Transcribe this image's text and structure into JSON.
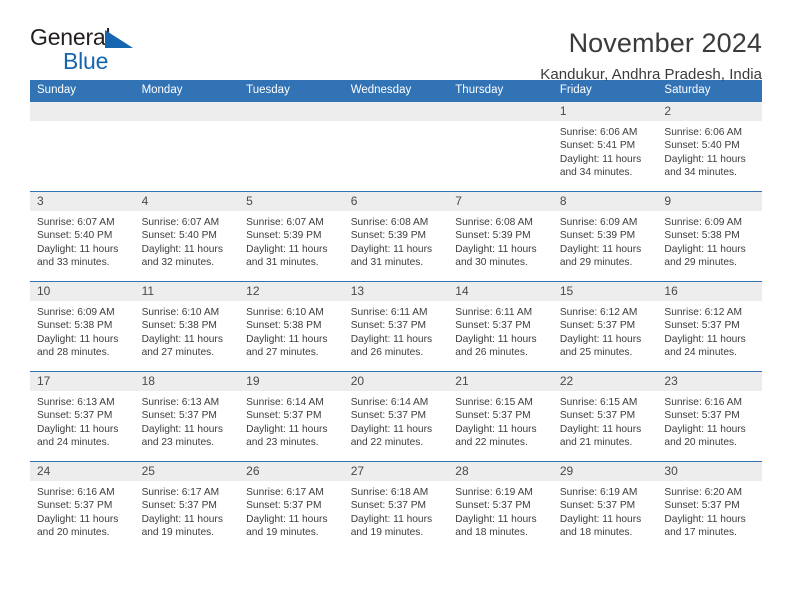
{
  "brand": {
    "name_part1": "General",
    "name_part2": "Blue",
    "triangle_icon": "triangle-icon",
    "accent_color": "#1565b0"
  },
  "header": {
    "title": "November 2024",
    "subtitle": "Kandukur, Andhra Pradesh, India"
  },
  "theme": {
    "header_blue": "#3273b5",
    "day_band_gray": "#ededed",
    "text_color": "#3d3d3d"
  },
  "weekdays": [
    "Sunday",
    "Monday",
    "Tuesday",
    "Wednesday",
    "Thursday",
    "Friday",
    "Saturday"
  ],
  "weeks": [
    [
      {
        "day": "",
        "empty": true
      },
      {
        "day": "",
        "empty": true
      },
      {
        "day": "",
        "empty": true
      },
      {
        "day": "",
        "empty": true
      },
      {
        "day": "",
        "empty": true
      },
      {
        "day": "1",
        "sunrise": "Sunrise: 6:06 AM",
        "sunset": "Sunset: 5:41 PM",
        "daylight_1": "Daylight: 11 hours",
        "daylight_2": "and 34 minutes."
      },
      {
        "day": "2",
        "sunrise": "Sunrise: 6:06 AM",
        "sunset": "Sunset: 5:40 PM",
        "daylight_1": "Daylight: 11 hours",
        "daylight_2": "and 34 minutes."
      }
    ],
    [
      {
        "day": "3",
        "sunrise": "Sunrise: 6:07 AM",
        "sunset": "Sunset: 5:40 PM",
        "daylight_1": "Daylight: 11 hours",
        "daylight_2": "and 33 minutes."
      },
      {
        "day": "4",
        "sunrise": "Sunrise: 6:07 AM",
        "sunset": "Sunset: 5:40 PM",
        "daylight_1": "Daylight: 11 hours",
        "daylight_2": "and 32 minutes."
      },
      {
        "day": "5",
        "sunrise": "Sunrise: 6:07 AM",
        "sunset": "Sunset: 5:39 PM",
        "daylight_1": "Daylight: 11 hours",
        "daylight_2": "and 31 minutes."
      },
      {
        "day": "6",
        "sunrise": "Sunrise: 6:08 AM",
        "sunset": "Sunset: 5:39 PM",
        "daylight_1": "Daylight: 11 hours",
        "daylight_2": "and 31 minutes."
      },
      {
        "day": "7",
        "sunrise": "Sunrise: 6:08 AM",
        "sunset": "Sunset: 5:39 PM",
        "daylight_1": "Daylight: 11 hours",
        "daylight_2": "and 30 minutes."
      },
      {
        "day": "8",
        "sunrise": "Sunrise: 6:09 AM",
        "sunset": "Sunset: 5:39 PM",
        "daylight_1": "Daylight: 11 hours",
        "daylight_2": "and 29 minutes."
      },
      {
        "day": "9",
        "sunrise": "Sunrise: 6:09 AM",
        "sunset": "Sunset: 5:38 PM",
        "daylight_1": "Daylight: 11 hours",
        "daylight_2": "and 29 minutes."
      }
    ],
    [
      {
        "day": "10",
        "sunrise": "Sunrise: 6:09 AM",
        "sunset": "Sunset: 5:38 PM",
        "daylight_1": "Daylight: 11 hours",
        "daylight_2": "and 28 minutes."
      },
      {
        "day": "11",
        "sunrise": "Sunrise: 6:10 AM",
        "sunset": "Sunset: 5:38 PM",
        "daylight_1": "Daylight: 11 hours",
        "daylight_2": "and 27 minutes."
      },
      {
        "day": "12",
        "sunrise": "Sunrise: 6:10 AM",
        "sunset": "Sunset: 5:38 PM",
        "daylight_1": "Daylight: 11 hours",
        "daylight_2": "and 27 minutes."
      },
      {
        "day": "13",
        "sunrise": "Sunrise: 6:11 AM",
        "sunset": "Sunset: 5:37 PM",
        "daylight_1": "Daylight: 11 hours",
        "daylight_2": "and 26 minutes."
      },
      {
        "day": "14",
        "sunrise": "Sunrise: 6:11 AM",
        "sunset": "Sunset: 5:37 PM",
        "daylight_1": "Daylight: 11 hours",
        "daylight_2": "and 26 minutes."
      },
      {
        "day": "15",
        "sunrise": "Sunrise: 6:12 AM",
        "sunset": "Sunset: 5:37 PM",
        "daylight_1": "Daylight: 11 hours",
        "daylight_2": "and 25 minutes."
      },
      {
        "day": "16",
        "sunrise": "Sunrise: 6:12 AM",
        "sunset": "Sunset: 5:37 PM",
        "daylight_1": "Daylight: 11 hours",
        "daylight_2": "and 24 minutes."
      }
    ],
    [
      {
        "day": "17",
        "sunrise": "Sunrise: 6:13 AM",
        "sunset": "Sunset: 5:37 PM",
        "daylight_1": "Daylight: 11 hours",
        "daylight_2": "and 24 minutes."
      },
      {
        "day": "18",
        "sunrise": "Sunrise: 6:13 AM",
        "sunset": "Sunset: 5:37 PM",
        "daylight_1": "Daylight: 11 hours",
        "daylight_2": "and 23 minutes."
      },
      {
        "day": "19",
        "sunrise": "Sunrise: 6:14 AM",
        "sunset": "Sunset: 5:37 PM",
        "daylight_1": "Daylight: 11 hours",
        "daylight_2": "and 23 minutes."
      },
      {
        "day": "20",
        "sunrise": "Sunrise: 6:14 AM",
        "sunset": "Sunset: 5:37 PM",
        "daylight_1": "Daylight: 11 hours",
        "daylight_2": "and 22 minutes."
      },
      {
        "day": "21",
        "sunrise": "Sunrise: 6:15 AM",
        "sunset": "Sunset: 5:37 PM",
        "daylight_1": "Daylight: 11 hours",
        "daylight_2": "and 22 minutes."
      },
      {
        "day": "22",
        "sunrise": "Sunrise: 6:15 AM",
        "sunset": "Sunset: 5:37 PM",
        "daylight_1": "Daylight: 11 hours",
        "daylight_2": "and 21 minutes."
      },
      {
        "day": "23",
        "sunrise": "Sunrise: 6:16 AM",
        "sunset": "Sunset: 5:37 PM",
        "daylight_1": "Daylight: 11 hours",
        "daylight_2": "and 20 minutes."
      }
    ],
    [
      {
        "day": "24",
        "sunrise": "Sunrise: 6:16 AM",
        "sunset": "Sunset: 5:37 PM",
        "daylight_1": "Daylight: 11 hours",
        "daylight_2": "and 20 minutes."
      },
      {
        "day": "25",
        "sunrise": "Sunrise: 6:17 AM",
        "sunset": "Sunset: 5:37 PM",
        "daylight_1": "Daylight: 11 hours",
        "daylight_2": "and 19 minutes."
      },
      {
        "day": "26",
        "sunrise": "Sunrise: 6:17 AM",
        "sunset": "Sunset: 5:37 PM",
        "daylight_1": "Daylight: 11 hours",
        "daylight_2": "and 19 minutes."
      },
      {
        "day": "27",
        "sunrise": "Sunrise: 6:18 AM",
        "sunset": "Sunset: 5:37 PM",
        "daylight_1": "Daylight: 11 hours",
        "daylight_2": "and 19 minutes."
      },
      {
        "day": "28",
        "sunrise": "Sunrise: 6:19 AM",
        "sunset": "Sunset: 5:37 PM",
        "daylight_1": "Daylight: 11 hours",
        "daylight_2": "and 18 minutes."
      },
      {
        "day": "29",
        "sunrise": "Sunrise: 6:19 AM",
        "sunset": "Sunset: 5:37 PM",
        "daylight_1": "Daylight: 11 hours",
        "daylight_2": "and 18 minutes."
      },
      {
        "day": "30",
        "sunrise": "Sunrise: 6:20 AM",
        "sunset": "Sunset: 5:37 PM",
        "daylight_1": "Daylight: 11 hours",
        "daylight_2": "and 17 minutes."
      }
    ]
  ]
}
